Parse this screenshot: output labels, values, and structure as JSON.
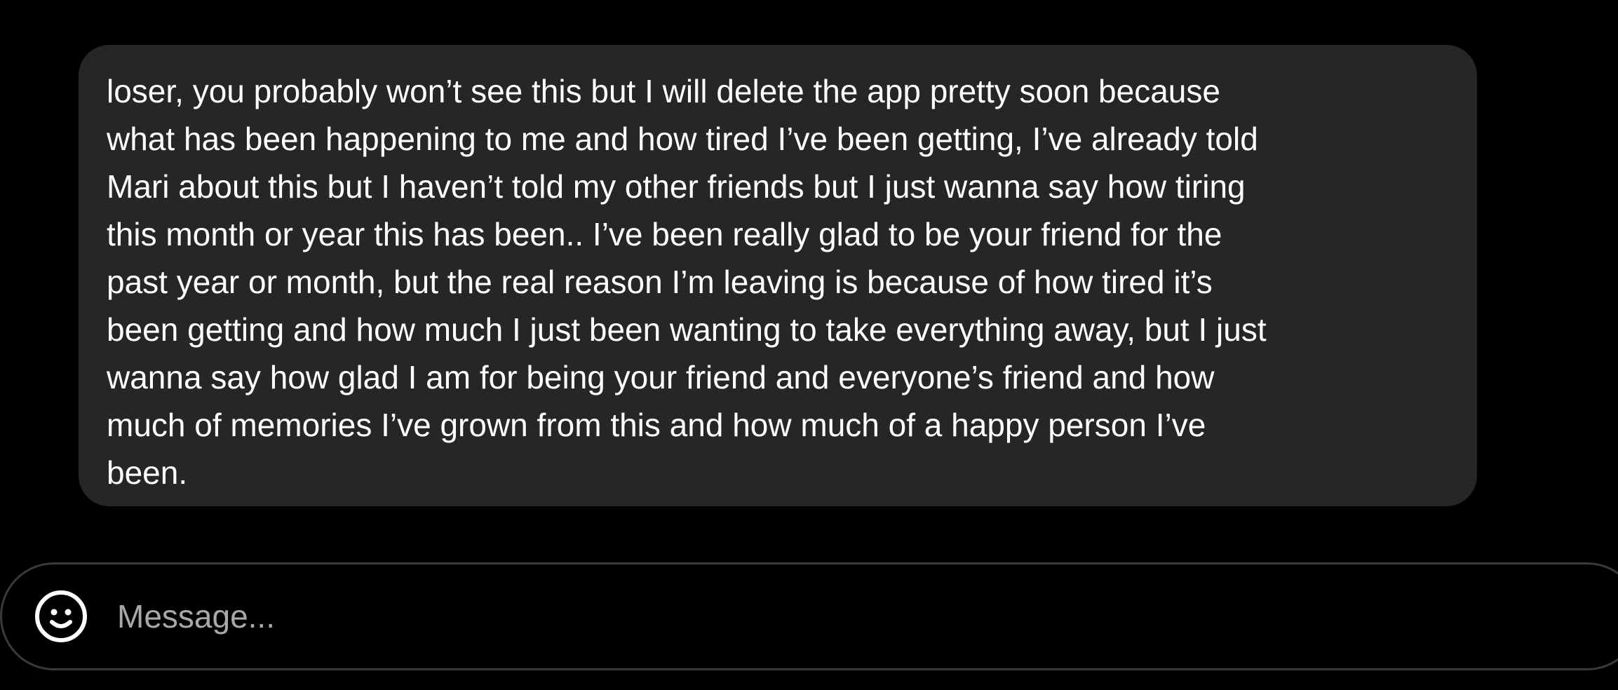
{
  "message": {
    "lines": [
      "loser,  you probably won’t see this but I will delete the app pretty soon because",
      "what has been happening to me and how tired I’ve been getting, I’ve already told",
      "Mari about this but I haven’t told my other friends but I just wanna say how tiring",
      "this month or year this has been.. I’ve been really glad to be your friend for the",
      "past year or month, but the real reason I’m leaving is because of how tired it’s",
      "been getting and how much I just been wanting to take everything away, but I just",
      "wanna say how glad I am for being your friend and everyone’s friend and how",
      "much of memories I’ve grown from this and how much of a happy person I’ve",
      "been."
    ],
    "bubble_color": "#262626",
    "text_color": "#ffffff"
  },
  "composer": {
    "placeholder": "Message...",
    "value": "",
    "emoji_icon": "smiley-face-icon",
    "border_color": "#3a3a3a",
    "placeholder_color": "#a8a8a8"
  },
  "colors": {
    "background": "#000000"
  }
}
